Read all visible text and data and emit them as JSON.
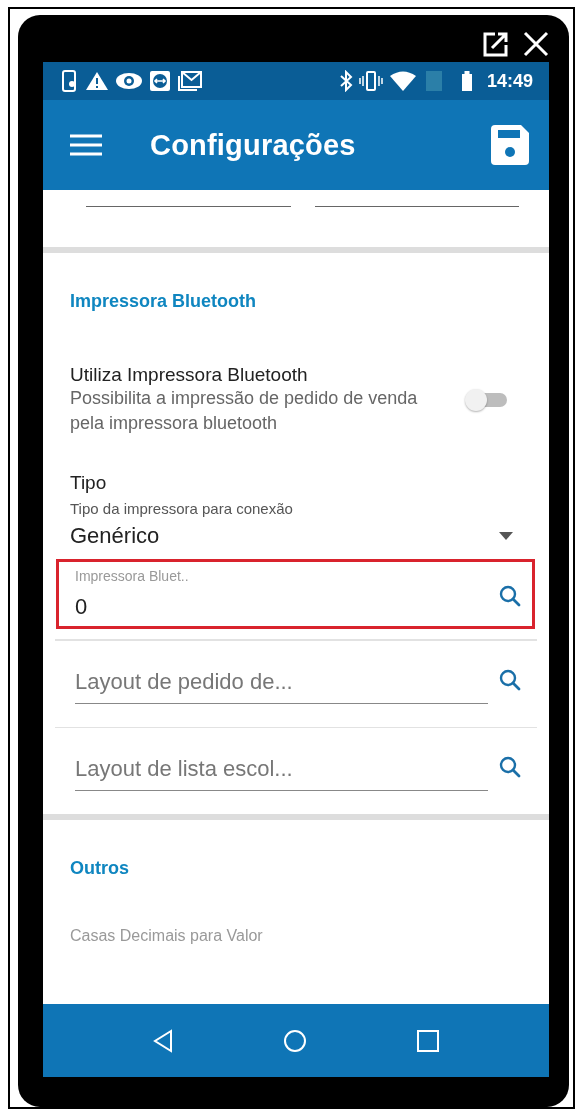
{
  "status_bar": {
    "time": "14:49"
  },
  "app_bar": {
    "title": "Configurações"
  },
  "sections": [
    {
      "title": "Impressora Bluetooth",
      "items": [
        {
          "kind": "switch",
          "label": "Utiliza Impressora Bluetooth",
          "description": "Possibilita a impressão de pedido de venda pela impressora bluetooth",
          "on": false
        },
        {
          "kind": "dropdown",
          "label": "Tipo",
          "description": "Tipo da impressora para conexão",
          "value": "Genérico"
        },
        {
          "kind": "lookup",
          "label": "Impressora Bluet..",
          "value": "0",
          "highlighted": true
        },
        {
          "kind": "lookup",
          "placeholder": "Layout de pedido de...",
          "highlighted": false
        },
        {
          "kind": "lookup",
          "placeholder": "Layout de lista escol...",
          "highlighted": false
        }
      ]
    },
    {
      "title": "Outros",
      "items": [
        {
          "kind": "caption",
          "label": "Casas Decimais para Valor"
        }
      ]
    }
  ]
}
